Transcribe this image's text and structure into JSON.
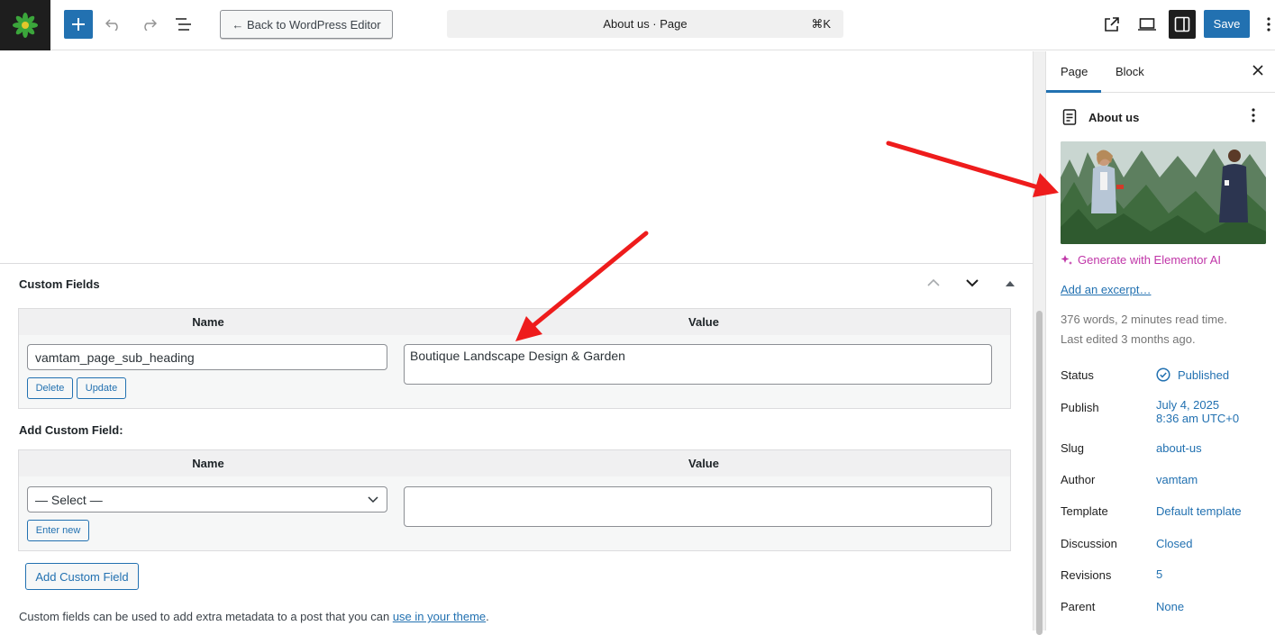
{
  "toolbar": {
    "back_label": "← Back to WordPress Editor",
    "command_title": "About us · Page",
    "command_shortcut": "⌘K",
    "save_label": "Save"
  },
  "custom_fields": {
    "title": "Custom Fields",
    "header_name": "Name",
    "header_value": "Value",
    "existing": {
      "name": "vamtam_page_sub_heading",
      "value": "Boutique Landscape Design & Garden",
      "delete_label": "Delete",
      "update_label": "Update"
    },
    "add_label": "Add Custom Field:",
    "add_header_name": "Name",
    "add_header_value": "Value",
    "select_value": "— Select —",
    "enter_new_label": "Enter new",
    "add_button_label": "Add Custom Field",
    "note_text": "Custom fields can be used to add extra metadata to a post that you can ",
    "note_link": "use in your theme",
    "note_end": "."
  },
  "sidebar": {
    "tab_page": "Page",
    "tab_block": "Block",
    "doc_title": "About us",
    "generate_ai": "Generate with Elementor AI",
    "excerpt_link": "Add an excerpt…",
    "stats_words": "376 words, 2 minutes read time.",
    "stats_edited": "Last edited 3 months ago.",
    "rows": {
      "status_label": "Status",
      "status_value": "Published",
      "publish_label": "Publish",
      "publish_date": "July 4, 2025",
      "publish_time": "8:36 am UTC+0",
      "slug_label": "Slug",
      "slug_value": "about-us",
      "author_label": "Author",
      "author_value": "vamtam",
      "template_label": "Template",
      "template_value": "Default template",
      "discussion_label": "Discussion",
      "discussion_value": "Closed",
      "revisions_label": "Revisions",
      "revisions_value": "5",
      "parent_label": "Parent",
      "parent_value": "None"
    }
  },
  "colors": {
    "accent": "#2271b1",
    "ai": "#c036a8",
    "annotation_arrow": "#ee1c1c"
  }
}
